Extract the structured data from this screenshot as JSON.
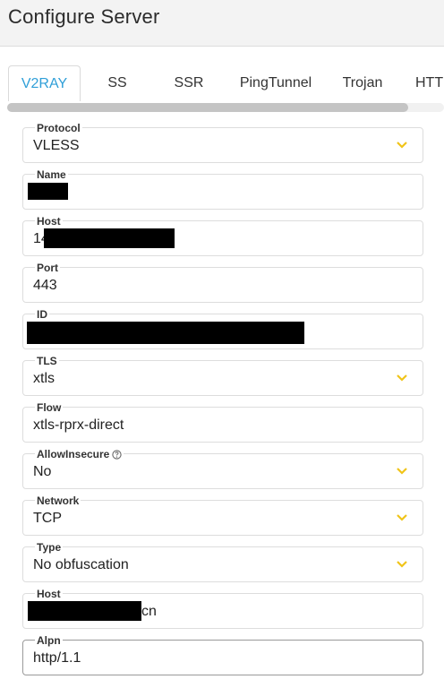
{
  "header": {
    "title": "Configure Server"
  },
  "tabs": [
    {
      "label": "V2RAY",
      "active": true
    },
    {
      "label": "SS"
    },
    {
      "label": "SSR"
    },
    {
      "label": "PingTunnel"
    },
    {
      "label": "Trojan"
    },
    {
      "label": "HTTP"
    }
  ],
  "form": {
    "protocol": {
      "label": "Protocol",
      "value": "VLESS"
    },
    "name": {
      "label": "Name",
      "value": ""
    },
    "host": {
      "label": "Host",
      "value_prefix": "14"
    },
    "port": {
      "label": "Port",
      "value": "443"
    },
    "id": {
      "label": "ID",
      "value": ""
    },
    "tls": {
      "label": "TLS",
      "value": "xtls"
    },
    "flow": {
      "label": "Flow",
      "value": "xtls-rprx-direct"
    },
    "allow_insecure": {
      "label": "AllowInsecure",
      "value": "No",
      "help_icon": "question-circle-icon"
    },
    "network": {
      "label": "Network",
      "value": "TCP"
    },
    "type": {
      "label": "Type",
      "value": "No obfuscation"
    },
    "host2": {
      "label": "Host",
      "value_suffix": "cn"
    },
    "alpn": {
      "label": "Alpn",
      "value": "http/1.1"
    }
  },
  "colors": {
    "accent": "#2f9fd8",
    "chevron": "#f0c419",
    "redaction": "#000000"
  }
}
